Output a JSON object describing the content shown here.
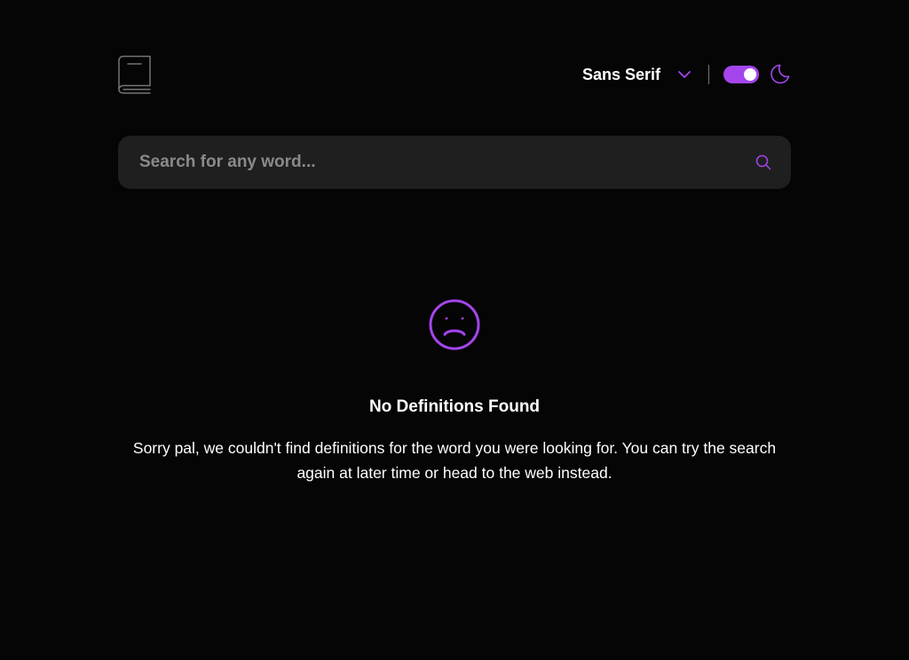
{
  "header": {
    "logo_icon": "book-icon",
    "font_selector": {
      "selected": "Sans Serif",
      "icon": "chevron-down-icon"
    },
    "theme_toggle": {
      "state": "dark",
      "icon": "moon-icon"
    }
  },
  "search": {
    "placeholder": "Search for any word...",
    "value": "",
    "icon": "search-icon"
  },
  "empty_state": {
    "icon": "sad-face-icon",
    "title": "No Definitions Found",
    "message": "Sorry pal, we couldn't find definitions for the word you were looking for. You can try the search again at later time or head to the web instead."
  },
  "colors": {
    "accent": "#a445ed",
    "background": "#050505",
    "surface": "#1f1f1f",
    "text": "#ffffff",
    "muted": "#757575"
  }
}
